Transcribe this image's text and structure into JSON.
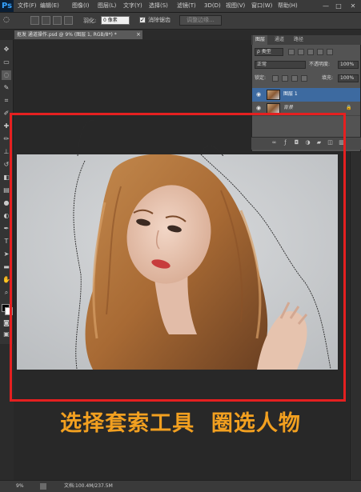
{
  "app": {
    "logo": "Ps",
    "menus": [
      "文件(F)",
      "编辑(E)",
      "图像(I)",
      "图层(L)",
      "文字(Y)",
      "选择(S)",
      "滤镜(T)",
      "3D(D)",
      "视图(V)",
      "窗口(W)",
      "帮助(H)"
    ],
    "window_controls": [
      "—",
      "□",
      "✕"
    ]
  },
  "options_bar": {
    "feather_label": "羽化:",
    "feather_value": "0 像素",
    "antialias_check": "✓",
    "antialias_label": "消除锯齿",
    "refine_edge_label": "调整边缘..."
  },
  "document": {
    "tab_title": "抠发 通道操作.psd @ 9% (图层 1, RGB/8*) *",
    "close_glyph": "×"
  },
  "layers_panel": {
    "tabs": [
      "图层",
      "通道",
      "路径"
    ],
    "filter_kind": "ρ 类型",
    "blend_mode": "正常",
    "opacity_label": "不透明度:",
    "opacity_value": "100%",
    "lock_label": "锁定:",
    "fill_label": "填充:",
    "fill_value": "100%",
    "layers": [
      {
        "name": "图层 1",
        "selected": true
      },
      {
        "name": "背景",
        "selected": false,
        "locked": true
      }
    ],
    "lock_glyph": "🔒",
    "footer_icons": [
      "link-icon",
      "fx-icon",
      "mask-icon",
      "adjustment-icon",
      "folder-icon",
      "new-layer-icon",
      "trash-icon"
    ]
  },
  "caption": "选择套索工具  圈选人物",
  "status": {
    "zoom": "9%",
    "doc_info": "文档:100.4M/237.5M"
  },
  "colors": {
    "highlight_box": "#e52020",
    "caption": "#f2a020",
    "selected_layer": "#3d6aa0"
  }
}
